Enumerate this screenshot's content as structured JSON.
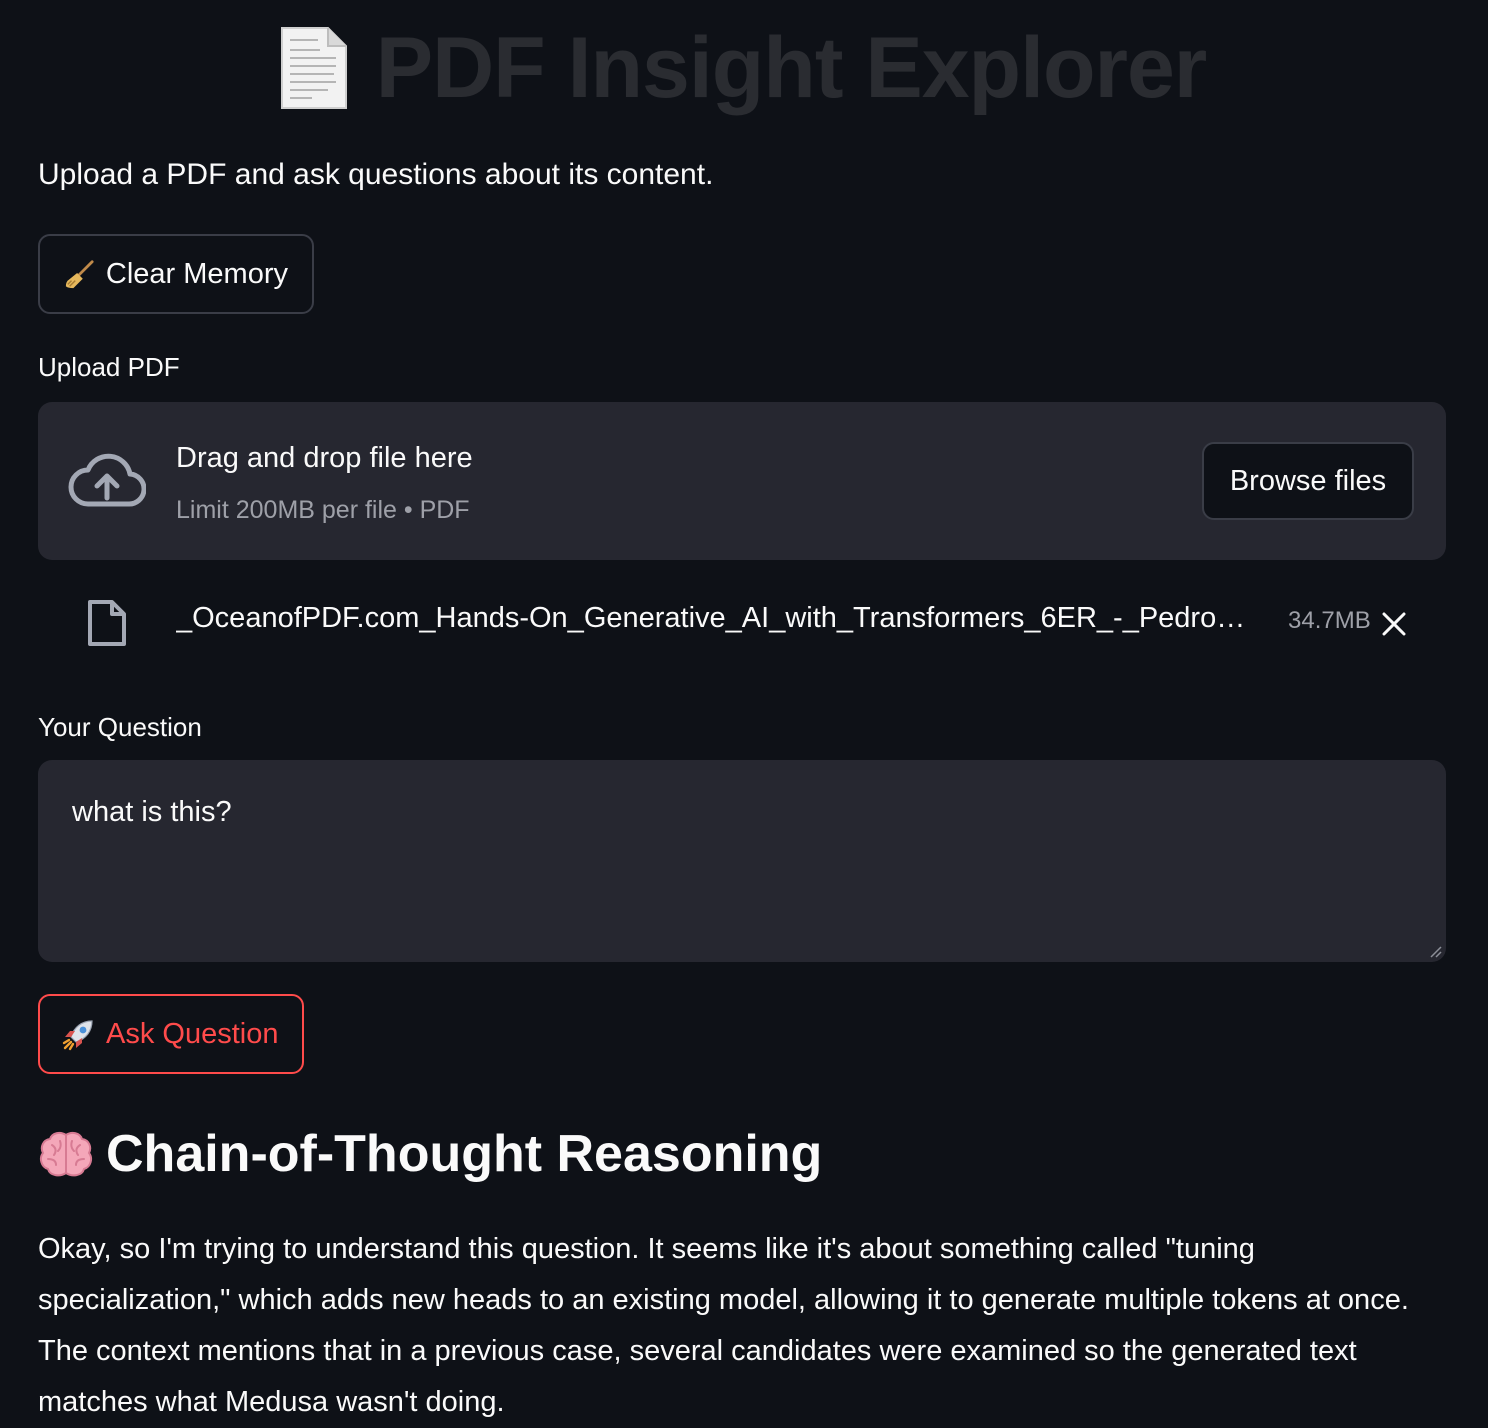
{
  "header": {
    "title": "PDF Insight Explorer",
    "title_icon": "page-facing-up-icon"
  },
  "subtitle": "Upload a PDF and ask questions about its content.",
  "clear_button": {
    "icon": "broom-icon",
    "label": "Clear Memory"
  },
  "upload": {
    "label": "Upload PDF",
    "drop_text": "Drag and drop file here",
    "limit_text": "Limit 200MB per file • PDF",
    "browse_label": "Browse files",
    "icon": "cloud-upload-icon"
  },
  "uploaded_file": {
    "name": "_OceanofPDF.com_Hands-On_Generative_AI_with_Transformers_6ER_-_Pedro…",
    "size": "34.7MB",
    "icon": "file-icon",
    "remove_icon": "close-icon"
  },
  "question": {
    "label": "Your Question",
    "value": "what is this?"
  },
  "ask_button": {
    "icon": "rocket-icon",
    "label": "Ask Question"
  },
  "reasoning": {
    "icon": "brain-icon",
    "heading": "Chain-of-Thought Reasoning",
    "text": "Okay, so I'm trying to understand this question. It seems like it's about something called \"tuning specialization,\" which adds new heads to an existing model, allowing it to generate multiple tokens at once. The context mentions that in a previous case, several candidates were examined so the generated text matches what Medusa wasn't doing."
  },
  "colors": {
    "background": "#0e1117",
    "surface": "#262730",
    "accent": "#ff4b4b",
    "text": "#fafafa",
    "muted": "#9ea0a8"
  }
}
